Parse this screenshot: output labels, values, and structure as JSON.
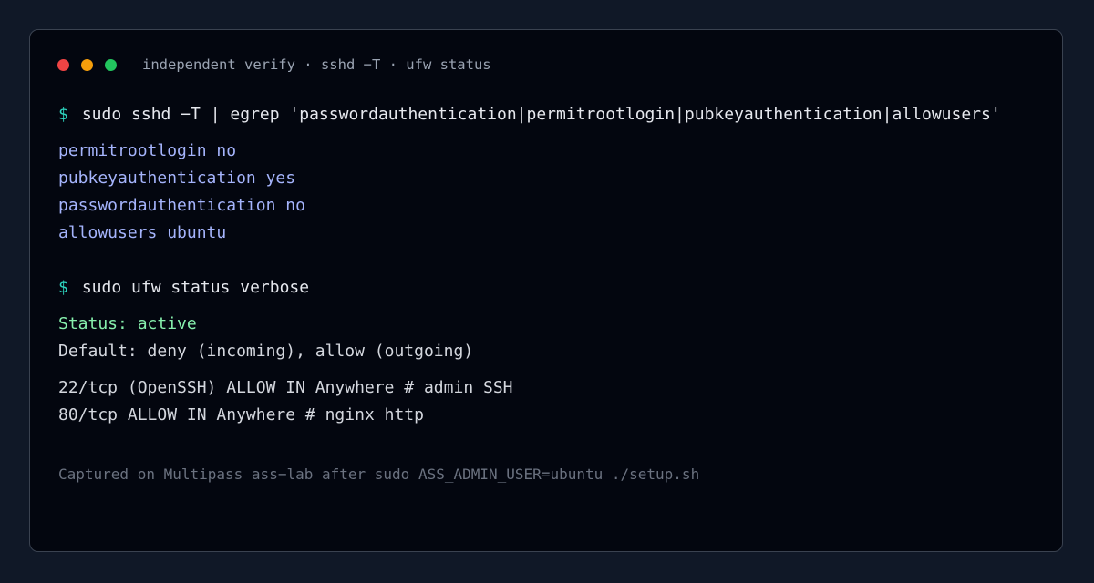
{
  "window": {
    "title": "independent verify · sshd −T · ufw status",
    "traffic_lights": [
      "#ef4444",
      "#f59e0b",
      "#22c55e"
    ]
  },
  "terminal": {
    "prompt_symbol": "$",
    "command_1": "sudo sshd −T | egrep 'passwordauthentication|permitrootlogin|pubkeyauthentication|allowusers'",
    "sshd_output": [
      "permitrootlogin no",
      "pubkeyauthentication yes",
      "passwordauthentication no",
      "allowusers ubuntu"
    ],
    "command_2": "sudo ufw status verbose",
    "ufw_status": "Status: active",
    "ufw_default": "Default: deny (incoming), allow (outgoing)",
    "ufw_rules": [
      "22/tcp (OpenSSH) ALLOW IN Anywhere # admin SSH",
      "80/tcp ALLOW IN Anywhere # nginx http"
    ],
    "footer": "Captured on Multipass ass−lab after sudo ASS_ADMIN_USER=ubuntu ./setup.sh"
  },
  "colors": {
    "prompt": "#2dd4bf",
    "sshd_output": "#a5b4fc",
    "status_active": "#86efac",
    "background": "#03060f"
  }
}
